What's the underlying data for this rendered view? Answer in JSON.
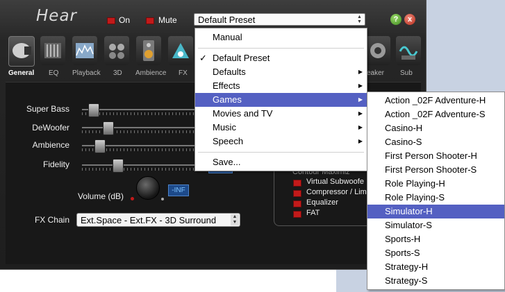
{
  "app": {
    "title": "Hear"
  },
  "header": {
    "on_label": "On",
    "mute_label": "Mute",
    "preset_value": "Default Preset",
    "help_glyph": "?",
    "close_glyph": "x"
  },
  "tabs": [
    {
      "label": "General",
      "active": true
    },
    {
      "label": "EQ"
    },
    {
      "label": "Playback"
    },
    {
      "label": "3D"
    },
    {
      "label": "Ambience"
    },
    {
      "label": "FX"
    },
    {
      "label": "eaker"
    },
    {
      "label": "Sub"
    }
  ],
  "sliders": [
    {
      "label": "Super Bass",
      "value": 0.06
    },
    {
      "label": "DeWoofer",
      "value": 0.2
    },
    {
      "label": "Ambience",
      "value": 0.12
    },
    {
      "label": "Fidelity",
      "value": 0.3
    }
  ],
  "volume": {
    "label": "Volume (dB)",
    "readout": "-INF"
  },
  "fx_chain": {
    "label": "FX Chain",
    "value": "Ext.Space - Ext.FX - 3D Surround"
  },
  "fx_list": [
    "Contour Maximiz",
    "Virtual Subwoofe",
    "Compressor / Lim",
    "Equalizer",
    "FAT"
  ],
  "preset_menu": {
    "items": [
      {
        "label": "Manual"
      },
      {
        "label": "Default Preset",
        "checked": true
      },
      {
        "label": "Defaults",
        "submenu": true
      },
      {
        "label": "Effects",
        "submenu": true
      },
      {
        "label": "Games",
        "submenu": true,
        "highlighted": true
      },
      {
        "label": "Movies and TV",
        "submenu": true
      },
      {
        "label": "Music",
        "submenu": true
      },
      {
        "label": "Speech",
        "submenu": true
      },
      {
        "label": "Save..."
      }
    ]
  },
  "games_menu": {
    "items": [
      "Action _02F Adventure-H",
      "Action _02F Adventure-S",
      "Casino-H",
      "Casino-S",
      "First Person Shooter-H",
      "First Person Shooter-S",
      "Role Playing-H",
      "Role Playing-S",
      "Simulator-H",
      "Simulator-S",
      "Sports-H",
      "Sports-S",
      "Strategy-H",
      "Strategy-S"
    ],
    "highlighted": "Simulator-H"
  },
  "colors": {
    "highlight": "#5460c2",
    "led_red": "#c21a1a"
  }
}
